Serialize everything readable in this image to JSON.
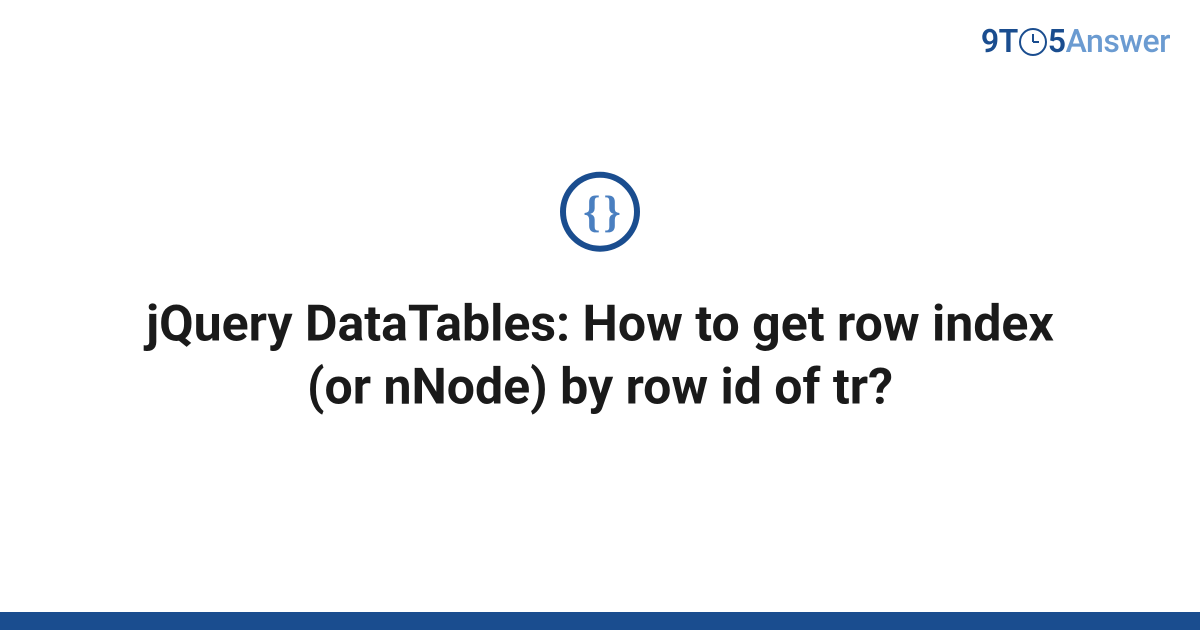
{
  "logo": {
    "part1": "9T",
    "part2": "5",
    "part3": "Answer"
  },
  "badge": {
    "symbol": "{ }"
  },
  "title": "jQuery DataTables: How to get row index (or nNode) by row id of tr?",
  "colors": {
    "primary": "#1a4d8f",
    "secondary": "#6b9bd1",
    "accent": "#4a7fc0"
  }
}
